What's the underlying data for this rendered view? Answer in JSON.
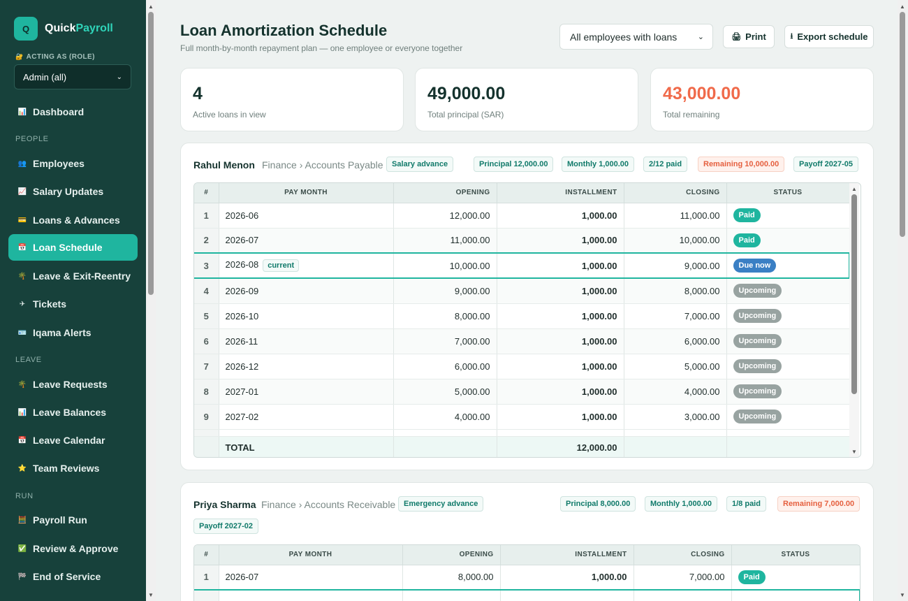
{
  "app": {
    "logo_letter": "Q",
    "name_a": "Quick",
    "name_b": "Payroll"
  },
  "role": {
    "label": "ACTING AS (ROLE)",
    "selected": "Admin (all)"
  },
  "sidebar": {
    "dashboard": "Dashboard",
    "people_label": "PEOPLE",
    "employees": "Employees",
    "salary_updates": "Salary Updates",
    "loans_advances": "Loans & Advances",
    "loan_schedule": "Loan Schedule",
    "leave_exit": "Leave & Exit-Reentry",
    "tickets": "Tickets",
    "iqama_alerts": "Iqama Alerts",
    "leave_label": "LEAVE",
    "leave_requests": "Leave Requests",
    "leave_balances": "Leave Balances",
    "leave_calendar": "Leave Calendar",
    "team_reviews": "Team Reviews",
    "run_label": "RUN",
    "payroll_run": "Payroll Run",
    "review_approve": "Review & Approve",
    "end_of_service": "End of Service"
  },
  "header": {
    "title": "Loan Amortization Schedule",
    "subtitle": "Full month-by-month repayment plan — one employee or everyone together",
    "employee_filter": "All employees with loans",
    "print": "Print",
    "export": "Export schedule"
  },
  "stats": {
    "active_loans": "4",
    "active_loans_label": "Active loans in view",
    "total_principal": "49,000.00",
    "total_principal_label": "Total principal (SAR)",
    "total_remaining": "43,000.00",
    "total_remaining_label": "Total remaining"
  },
  "columns": {
    "num": "#",
    "pay_month": "PAY MONTH",
    "opening": "OPENING",
    "installment": "INSTALLMENT",
    "closing": "CLOSING",
    "status": "STATUS"
  },
  "loan1": {
    "name": "Rahul Menon",
    "dept": "Finance › Accounts Payable",
    "type": "Salary advance",
    "principal": "Principal 12,000.00",
    "monthly": "Monthly 1,000.00",
    "paid": "2/12 paid",
    "remaining": "Remaining 10,000.00",
    "payoff": "Payoff 2027-05",
    "current_label": "current",
    "rows": [
      {
        "i": "1",
        "month": "2026-06",
        "opening": "12,000.00",
        "inst": "1,000.00",
        "closing": "11,000.00",
        "status": "Paid"
      },
      {
        "i": "2",
        "month": "2026-07",
        "opening": "11,000.00",
        "inst": "1,000.00",
        "closing": "10,000.00",
        "status": "Paid"
      },
      {
        "i": "3",
        "month": "2026-08",
        "opening": "10,000.00",
        "inst": "1,000.00",
        "closing": "9,000.00",
        "status": "Due now"
      },
      {
        "i": "4",
        "month": "2026-09",
        "opening": "9,000.00",
        "inst": "1,000.00",
        "closing": "8,000.00",
        "status": "Upcoming"
      },
      {
        "i": "5",
        "month": "2026-10",
        "opening": "8,000.00",
        "inst": "1,000.00",
        "closing": "7,000.00",
        "status": "Upcoming"
      },
      {
        "i": "6",
        "month": "2026-11",
        "opening": "7,000.00",
        "inst": "1,000.00",
        "closing": "6,000.00",
        "status": "Upcoming"
      },
      {
        "i": "7",
        "month": "2026-12",
        "opening": "6,000.00",
        "inst": "1,000.00",
        "closing": "5,000.00",
        "status": "Upcoming"
      },
      {
        "i": "8",
        "month": "2027-01",
        "opening": "5,000.00",
        "inst": "1,000.00",
        "closing": "4,000.00",
        "status": "Upcoming"
      },
      {
        "i": "9",
        "month": "2027-02",
        "opening": "4,000.00",
        "inst": "1,000.00",
        "closing": "3,000.00",
        "status": "Upcoming"
      }
    ],
    "total_label": "TOTAL",
    "total_value": "12,000.00"
  },
  "loan2": {
    "name": "Priya Sharma",
    "dept": "Finance › Accounts Receivable",
    "type": "Emergency advance",
    "principal": "Principal 8,000.00",
    "monthly": "Monthly 1,000.00",
    "paid": "1/8 paid",
    "remaining": "Remaining 7,000.00",
    "payoff": "Payoff 2027-02",
    "rows": [
      {
        "i": "1",
        "month": "2026-07",
        "opening": "8,000.00",
        "inst": "1,000.00",
        "closing": "7,000.00",
        "status": "Paid"
      }
    ]
  },
  "colors": {
    "sidebar": "#17413b",
    "accent": "#1fb59f",
    "remaining": "#f06a4a",
    "due": "#3a7fc4",
    "upcoming": "#98a3a1"
  }
}
